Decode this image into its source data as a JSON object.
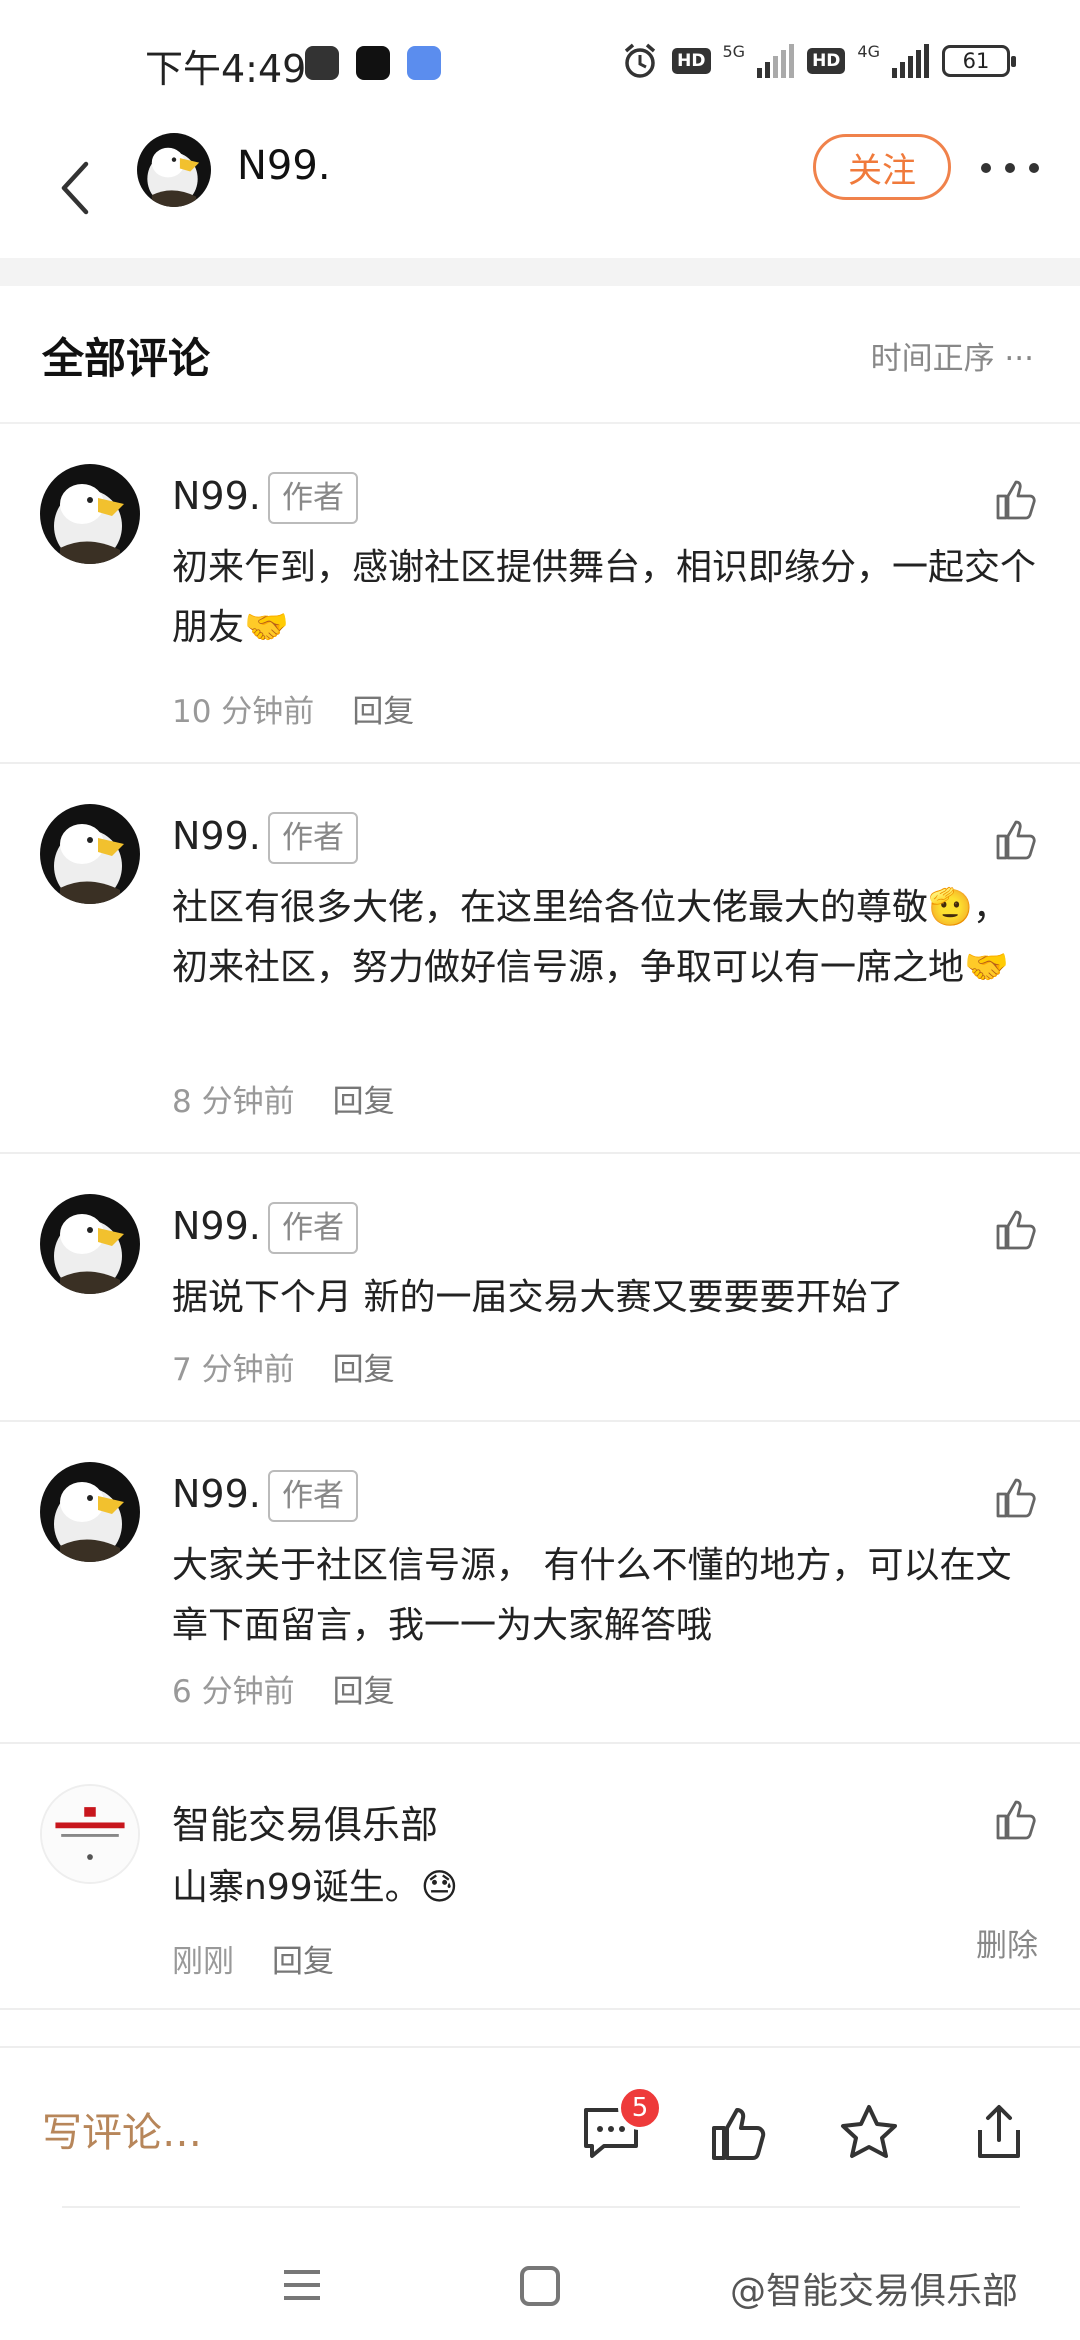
{
  "status_bar": {
    "time": "下午4:49",
    "hd1": "HD",
    "net1": "5G",
    "hd2": "HD",
    "net2": "4G",
    "battery": "61"
  },
  "header": {
    "name": "N99.",
    "follow_label": "关注"
  },
  "section": {
    "title": "全部评论",
    "sort_label": "时间正序 ···"
  },
  "comments": [
    {
      "name": "N99.",
      "tag": "作者",
      "text": "初来乍到，感谢社区提供舞台，相识即缘分，一起交个朋友🤝",
      "time": "10 分钟前",
      "reply": "回复"
    },
    {
      "name": "N99.",
      "tag": "作者",
      "text": "社区有很多大佬，在这里给各位大佬最大的尊敬🫡，初来社区，努力做好信号源，争取可以有一席之地🤝",
      "time": "8 分钟前",
      "reply": "回复"
    },
    {
      "name": "N99.",
      "tag": "作者",
      "text": "据说下个月 新的一届交易大赛又要要要开始了",
      "time": "7 分钟前",
      "reply": "回复"
    },
    {
      "name": "N99.",
      "tag": "作者",
      "text": "大家关于社区信号源， 有什么不懂的地方，可以在文章下面留言，我一一为大家解答哦",
      "time": "6 分钟前",
      "reply": "回复"
    },
    {
      "name": "智能交易俱乐部",
      "text": "山寨n99诞生。😓",
      "time": "刚刚",
      "reply": "回复",
      "delete": "删除"
    }
  ],
  "bottom_bar": {
    "write_placeholder": "写评论…",
    "comment_count": "5"
  },
  "watermark": "@智能交易俱乐部",
  "colors": {
    "accent": "#f07a3b",
    "write": "#b7865a",
    "badge": "#ee3a3a"
  }
}
